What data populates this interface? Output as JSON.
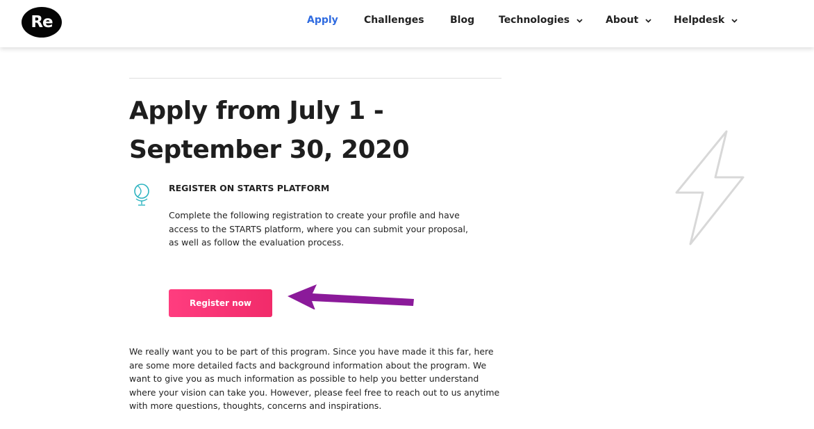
{
  "header": {
    "logo_text": "Re",
    "nav": [
      {
        "label": "Apply",
        "active": true
      },
      {
        "label": "Challenges",
        "active": false
      },
      {
        "label": "Blog",
        "active": false
      },
      {
        "label": "Technologies",
        "active": false,
        "dropdown": true
      },
      {
        "label": "About",
        "active": false,
        "dropdown": true
      },
      {
        "label": "Helpdesk",
        "active": false,
        "dropdown": true
      }
    ],
    "active_color": "#2f6be0"
  },
  "main": {
    "title_line1": "Apply from July 1 -",
    "title_line2": "September 30, 2020",
    "section": {
      "icon": "globe-icon",
      "heading": "REGISTER ON STARTS PLATFORM",
      "description": "Complete the following registration to create your profile and have access to the STARTS platform, where you can submit your proposal, as well as follow the evaluation process.",
      "button_label": "Register now",
      "button_color": "#f12b6a"
    },
    "body_text": "We really want you to be part of this program. Since you have made it this far, here are some more detailed facts and background information about the program. We want to give you as much information as possible to help you better understand where your vision can take you. However, please feel free to reach out to us anytime with more questions, thoughts, concerns and inspirations."
  },
  "decor": {
    "right_icon": "lightning-bolt-icon",
    "annotation_arrow_color": "#8b1a9a"
  }
}
